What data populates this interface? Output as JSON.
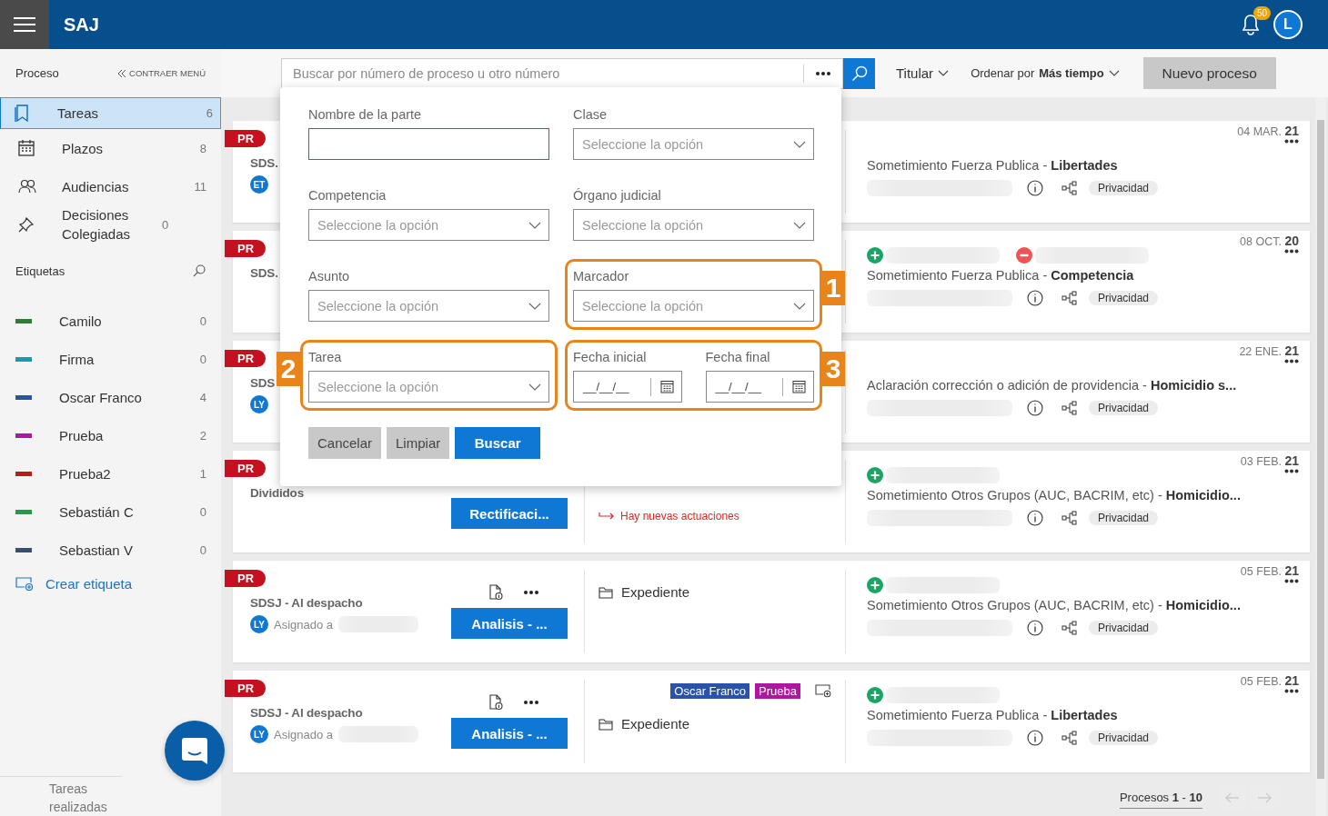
{
  "header": {
    "logo": "SAJ",
    "notifications": "50",
    "avatar": "L"
  },
  "sidebar": {
    "title": "Proceso",
    "collapse": "CONTRAER MENÚ",
    "items": [
      {
        "label": "Tareas",
        "count": "6",
        "selected": true
      },
      {
        "label": "Plazos",
        "count": "8",
        "selected": false
      },
      {
        "label": "Audiencias",
        "count": "11",
        "selected": false
      },
      {
        "label": "Decisiones Colegiadas",
        "count": "0",
        "selected": false
      }
    ],
    "tags_title": "Etiquetas",
    "tags": [
      {
        "label": "Camilo",
        "count": "0",
        "color": "#2e7d32"
      },
      {
        "label": "Firma",
        "count": "0",
        "color": "#1a9ba8"
      },
      {
        "label": "Oscar Franco",
        "count": "4",
        "color": "#2a52a8"
      },
      {
        "label": "Prueba",
        "count": "2",
        "color": "#b0179f"
      },
      {
        "label": "Prueba2",
        "count": "1",
        "color": "#b71c1c"
      },
      {
        "label": "Sebastián C",
        "count": "0",
        "color": "#1e9e48"
      },
      {
        "label": "Sebastian V",
        "count": "0",
        "color": "#37506b"
      }
    ],
    "create_tag": "Crear etiqueta",
    "footer": "Tareas realizadas"
  },
  "toolbar": {
    "search_placeholder": "Buscar por número de proceso u otro número",
    "filter": "Titular",
    "sort": "Ordenar por **Más tiempo**",
    "new_button": "Nuevo proceso"
  },
  "cards": [
    {
      "ribbon": "PR",
      "title": "SDS.",
      "avatar": "ET",
      "date": "04 MAR. **21**",
      "description": "Sometimiento Fuerza Publica - **Libertades**",
      "privacy": "Privacidad"
    },
    {
      "ribbon": "PR",
      "title": "SDS.",
      "date": "08 OCT. **20**",
      "changes": [
        {
          "kind": "added"
        },
        {
          "kind": "removed"
        }
      ],
      "description": "Sometimiento Fuerza Publica - **Competencia**",
      "privacy": "Privacidad"
    },
    {
      "ribbon": "PR",
      "title": "SDS",
      "avatar": "LY",
      "date": "22 ENE. **21**",
      "description": "Aclaración corrección o adición de providencia - **Homicidio s...**",
      "privacy": "Privacidad"
    },
    {
      "ribbon": "PR",
      "title": "Divididos",
      "action": "Rectificaci...",
      "notice": "Hay nuevas actuaciones",
      "date": "03 FEB. **21**",
      "changes": [
        {
          "kind": "added"
        }
      ],
      "description": "Sometimiento Otros Grupos (AUC, BACRIM, etc) - **Homicidio...**",
      "privacy": "Privacidad"
    },
    {
      "ribbon": "PR",
      "title": "SDSJ - Al despacho",
      "avatar": "LY",
      "assigned": "Asignado a",
      "action": "Analisis - ...",
      "show_tools": true,
      "expediente": "Expediente",
      "date": "05 FEB. **21**",
      "changes": [
        {
          "kind": "added"
        }
      ],
      "description": "Sometimiento Otros Grupos (AUC, BACRIM, etc) - **Homicidio...**",
      "privacy": "Privacidad"
    },
    {
      "ribbon": "PR",
      "title": "SDSJ - Al despacho",
      "avatar": "LY",
      "assigned": "Asignado a",
      "action": "Analisis - ...",
      "show_tools": true,
      "tags": [
        {
          "label": "Oscar Franco",
          "color": "#2a52a8"
        },
        {
          "label": "Prueba",
          "color": "#b0179f"
        }
      ],
      "expediente": "Expediente",
      "date": "05 FEB. **21**",
      "changes": [
        {
          "kind": "added"
        }
      ],
      "description": "Sometimiento Fuerza Publica - **Libertades**",
      "privacy": "Privacidad"
    }
  ],
  "pagination": "Procesos **1** - **10**",
  "popup": {
    "fields": [
      {
        "kind": "text",
        "label": "Nombre de la parte",
        "focused": true
      },
      {
        "kind": "select",
        "label": "Clase",
        "placeholder": "Seleccione la opción"
      },
      {
        "kind": "select",
        "label": "Competencia",
        "placeholder": "Seleccione la opción"
      },
      {
        "kind": "select",
        "label": "Órgano judicial",
        "placeholder": "Seleccione la opción"
      },
      {
        "kind": "select",
        "label": "Asunto",
        "placeholder": "Seleccione la opción"
      },
      {
        "kind": "select",
        "label": "Marcador",
        "placeholder": "Seleccione la opción",
        "callout": "1"
      },
      {
        "kind": "select",
        "label": "Tarea",
        "placeholder": "Seleccione la opción",
        "callout": "2"
      },
      {
        "kind": "dates",
        "callout": "3",
        "dates": [
          {
            "label": "Fecha inicial",
            "placeholder": "__/__/__"
          },
          {
            "label": "Fecha final",
            "placeholder": "__/__/__"
          }
        ]
      }
    ],
    "buttons": [
      {
        "label": "Cancelar",
        "kind": "secondary"
      },
      {
        "label": "Limpiar",
        "kind": "secondary"
      },
      {
        "label": "Buscar",
        "kind": "primary"
      }
    ]
  }
}
